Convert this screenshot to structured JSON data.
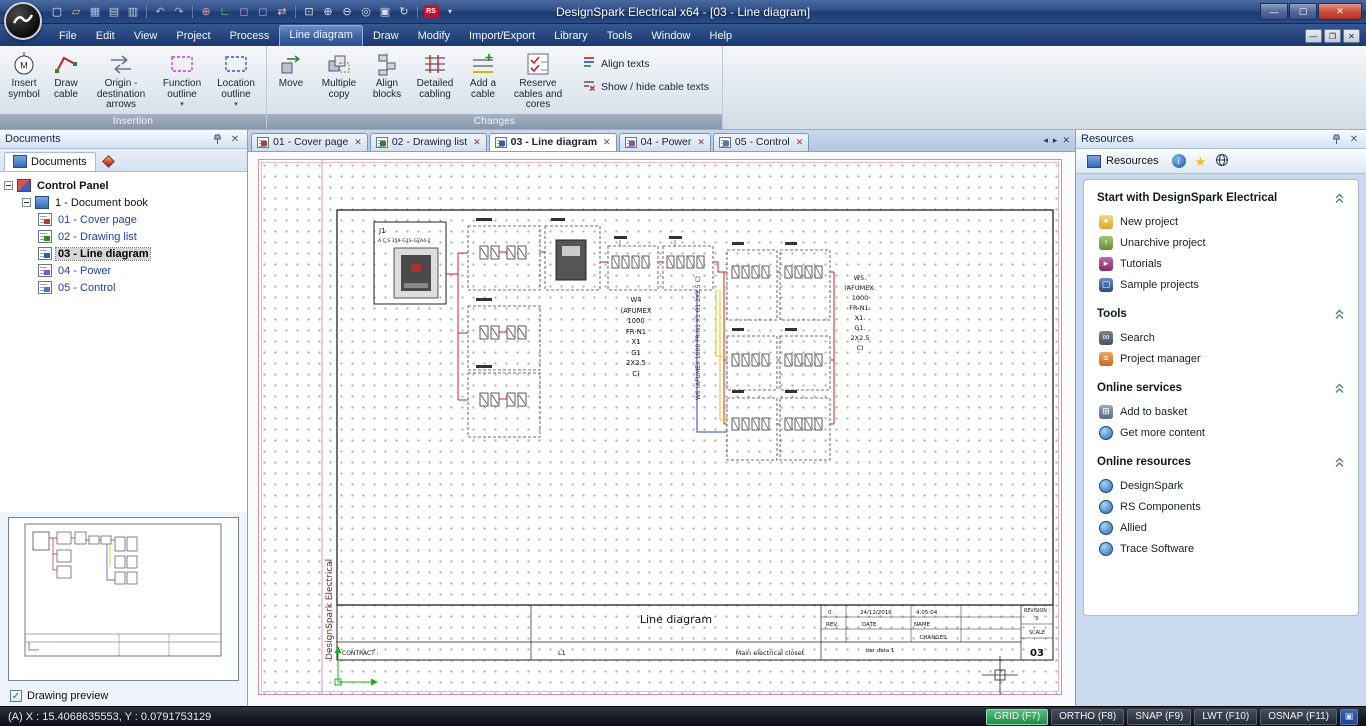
{
  "titlebar": {
    "title": "DesignSpark Electrical x64 - [03 - Line diagram]",
    "rs_glyph": "RS"
  },
  "menubar": {
    "items": [
      "File",
      "Edit",
      "View",
      "Project",
      "Process",
      "Line diagram",
      "Draw",
      "Modify",
      "Import/Export",
      "Library",
      "Tools",
      "Window",
      "Help"
    ]
  },
  "ribbon": {
    "motor_glyph": "M",
    "groups": [
      {
        "label": "Insertion",
        "buttons": [
          {
            "label": "Insert symbol"
          },
          {
            "label": "Draw cable"
          },
          {
            "label": "Origin - destination arrows"
          },
          {
            "label": "Function outline"
          },
          {
            "label": "Location outline"
          }
        ]
      },
      {
        "label": "Changes",
        "buttons": [
          {
            "label": "Move"
          },
          {
            "label": "Multiple copy"
          },
          {
            "label": "Align blocks"
          },
          {
            "label": "Detailed cabling"
          },
          {
            "label": "Add a cable"
          },
          {
            "label": "Reserve cables and cores"
          }
        ],
        "side_buttons": [
          {
            "label": "Align texts"
          },
          {
            "label": "Show / hide cable texts"
          }
        ]
      }
    ]
  },
  "document_tabs": [
    {
      "label": "01 - Cover page"
    },
    {
      "label": "02 - Drawing list"
    },
    {
      "label": "03 - Line diagram"
    },
    {
      "label": "04 - Power"
    },
    {
      "label": "05 - Control"
    }
  ],
  "documents_panel": {
    "title": "Documents",
    "tab_label": "Documents",
    "tree": [
      {
        "label": "Control Panel"
      },
      {
        "label": "1 - Document book"
      },
      {
        "label": "01 - Cover page"
      },
      {
        "label": "02 - Drawing list"
      },
      {
        "label": "03 - Line diagram"
      },
      {
        "label": "04 - Power"
      },
      {
        "label": "05 - Control"
      }
    ],
    "preview_label": "Drawing preview"
  },
  "canvas": {
    "side_text": "DesignSpark Electrical",
    "j1_tag": "J1",
    "j1_ref": "A C S 359-G1S-G2A4-2",
    "w4_lines": [
      "W4",
      "(AFUMEX",
      "1000",
      "FR-N1",
      "X1",
      "G1",
      "2X2.5",
      "C)"
    ],
    "w5_lines": [
      "W5.",
      "(AFUMEX.",
      "1000",
      "FR-N1.",
      "X1.",
      "G1.",
      "2X2.5",
      "C)"
    ],
    "w6_text": "W6 (AFUMEX 1000 FR-N1 X1 G1 2X2.5 C)",
    "title_block": {
      "title": "Line diagram",
      "contract_label": "CONTRACT :",
      "column_value": "L1",
      "location": "Main electrical closet",
      "rev": "0 .",
      "date": "24/12/2016",
      "time": "4:05:04",
      "header_rev": "REV.",
      "header_date": "DATE",
      "header_name": "NAME",
      "changes_label": "CHANGES",
      "bar_data": "bar data 1",
      "revision_label": "REVISION :",
      "revision_value": "0",
      "scale_label": "SCALE",
      "folio": "03"
    }
  },
  "resources_panel": {
    "title": "Resources",
    "toolbar_button": "Resources",
    "sections": [
      {
        "title": "Start with DesignSpark Electrical",
        "items": [
          {
            "label": "New project"
          },
          {
            "label": "Unarchive project"
          },
          {
            "label": "Tutorials"
          },
          {
            "label": "Sample projects"
          }
        ]
      },
      {
        "title": "Tools",
        "items": [
          {
            "label": "Search"
          },
          {
            "label": "Project manager"
          }
        ]
      },
      {
        "title": "Online services",
        "items": [
          {
            "label": "Add to basket"
          },
          {
            "label": "Get more content"
          }
        ]
      },
      {
        "title": "Online resources",
        "items": [
          {
            "label": "DesignSpark"
          },
          {
            "label": "RS Components"
          },
          {
            "label": "Allied"
          },
          {
            "label": "Trace Software"
          }
        ]
      }
    ]
  },
  "statusbar": {
    "coords": "(A) X : 15.4068635553, Y : 0.0791753129",
    "toggles": [
      {
        "label": "GRID (F7)"
      },
      {
        "label": "ORTHO (F8)"
      },
      {
        "label": "SNAP (F9)"
      },
      {
        "label": "LWT (F10)"
      },
      {
        "label": "OSNAP (F11)"
      }
    ]
  }
}
